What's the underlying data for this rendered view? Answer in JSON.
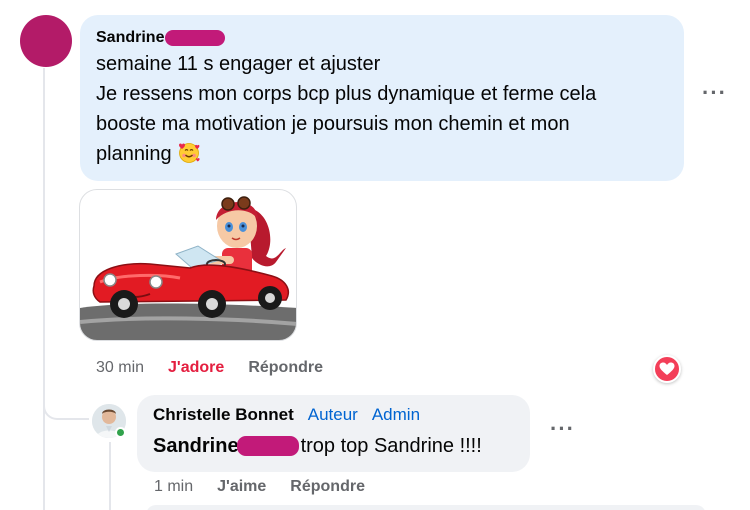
{
  "comment": {
    "author": "Sandrine",
    "lines": [
      "semaine 11 s engager et ajuster",
      "Je ressens mon corps bcp plus dynamique et ferme cela",
      "booste ma motivation je poursuis mon chemin et mon",
      "planning"
    ],
    "emoji": "smiling-face-with-hearts",
    "sticker": "cartoon girl driving red car sticker",
    "time": "30 min",
    "reacted_label": "J'adore",
    "reply_label": "Répondre",
    "reaction_icon": "heart-icon"
  },
  "reply": {
    "author": "Christelle Bonnet",
    "badges": [
      "Auteur",
      "Admin"
    ],
    "mention": "Sandrine",
    "text": "trop top Sandrine !!!!",
    "time": "1 min",
    "like_label": "J'aime",
    "reply_label": "Répondre",
    "online": true
  },
  "colors": {
    "bubble_main": "#e4f0fc",
    "bubble_reply": "#f0f2f5",
    "love": "#e41e3f",
    "badge": "#0064d1",
    "redaction": "#c21a79"
  }
}
